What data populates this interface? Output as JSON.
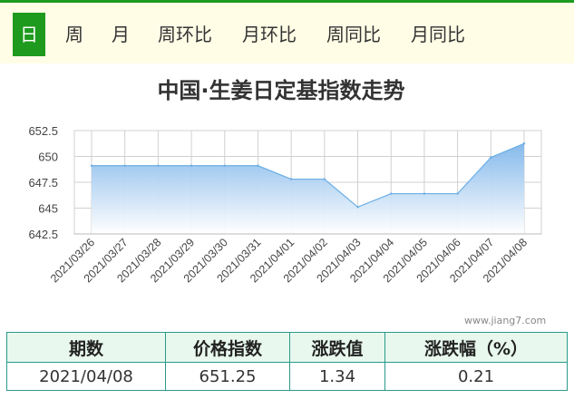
{
  "tabs": [
    {
      "label": "日",
      "active": true
    },
    {
      "label": "周",
      "active": false
    },
    {
      "label": "月",
      "active": false
    },
    {
      "label": "周环比",
      "active": false
    },
    {
      "label": "月环比",
      "active": false
    },
    {
      "label": "周同比",
      "active": false
    },
    {
      "label": "月同比",
      "active": false
    }
  ],
  "chart_title": "中国·生姜日定基指数走势",
  "watermark": "www.jiang7.com",
  "colors": {
    "accent": "#1e9a1e",
    "tab_bar_bg": "#fffde6",
    "area_top": "#7fb6ea",
    "area_bottom": "#ffffff",
    "line": "#6aaee6",
    "table_border": "#2a9a8a",
    "table_header_bg": "#e8f8ee"
  },
  "chart_data": {
    "type": "area",
    "title": "中国·生姜日定基指数走势",
    "xlabel": "",
    "ylabel": "",
    "categories": [
      "2021/03/26",
      "2021/03/27",
      "2021/03/28",
      "2021/03/29",
      "2021/03/30",
      "2021/03/31",
      "2021/04/01",
      "2021/04/02",
      "2021/04/03",
      "2021/04/04",
      "2021/04/05",
      "2021/04/06",
      "2021/04/07",
      "2021/04/08"
    ],
    "values": [
      649.1,
      649.1,
      649.1,
      649.1,
      649.1,
      649.1,
      647.8,
      647.8,
      645.1,
      646.4,
      646.4,
      646.4,
      649.9,
      651.25
    ],
    "ylim": [
      642.5,
      652.5
    ],
    "yticks": [
      "642.5",
      "645",
      "647.5",
      "650",
      "652.5"
    ],
    "grid": true,
    "legend": "none"
  },
  "table": {
    "headers": [
      "期数",
      "价格指数",
      "涨跌值",
      "涨跌幅（%）"
    ],
    "rows": [
      [
        "2021/04/08",
        "651.25",
        "1.34",
        "0.21"
      ]
    ]
  }
}
